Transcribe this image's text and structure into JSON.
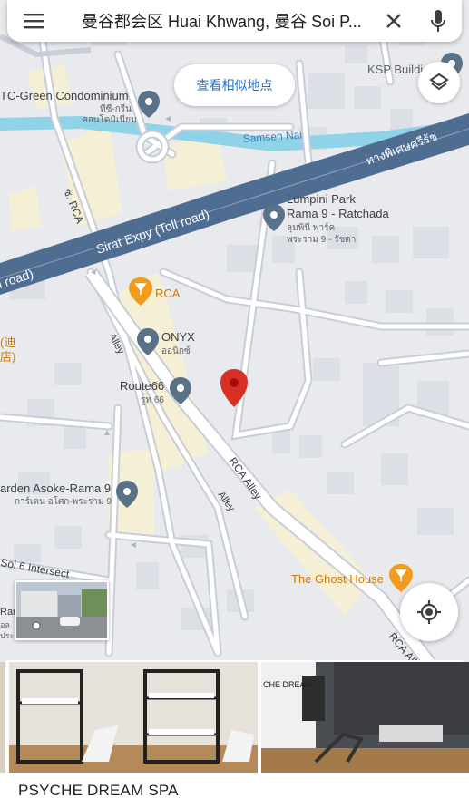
{
  "search": {
    "query": "曼谷都会区 Huai Khwang, 曼谷 Soi P...",
    "menu_icon": "menu-icon",
    "close_icon": "close-icon",
    "mic_icon": "mic-icon"
  },
  "similar_places_button": "查看相似地点",
  "map": {
    "labels": {
      "ksp": "KSP Buildi",
      "condo": "TC-Green Condominium",
      "condo_th": "ทีซี-กรีน",
      "condo_th2": "คอนโดมิเนียม",
      "samsen": "Samsen Nai",
      "thai_expy": "ทางพิเศษศรีรัช",
      "rca_road": "ซ. RCA",
      "lumpini1": "Lumpini Park",
      "lumpini2": "Rama 9 - Ratchada",
      "lumpini_th1": "ลุมพินี พาร์ค",
      "lumpini_th2": "พระราม 9 - รัชดา",
      "sirat": "Sirat Expy (Toll road)",
      "road_left": "l road)",
      "rca_poi": "RCA",
      "onyx": "ONYX",
      "onyx_th": "ออนิกซ์",
      "alley": "Alley",
      "route66": "Route66",
      "route66_th": "รูท 66",
      "left_cn1": "(迪",
      "left_cn2": "店)",
      "rca_alley": "RCA Alley",
      "alley2": "Alley",
      "garden": "arden Asoke-Rama 9",
      "garden_th": "การ์เดน อโศก-พระราม 9",
      "soi6": "Soi 6 Intersect",
      "ghost": "The Ghost House",
      "rca_all": "RCA All",
      "ran": "Ran",
      "ran2": "อล",
      "ran3": "ประ"
    }
  },
  "place": {
    "name": "PSYCHE DREAM SPA"
  },
  "colors": {
    "expressway": "#4f6d91",
    "water": "#8fd3e8",
    "road": "#ffffff",
    "minor_road": "#c8cdd8",
    "building": "#dfe2e8",
    "poi_blue": "#5a7288",
    "poi_orange": "#f29c1f",
    "pin_red": "#d93025",
    "accent": "#1a73e8"
  }
}
